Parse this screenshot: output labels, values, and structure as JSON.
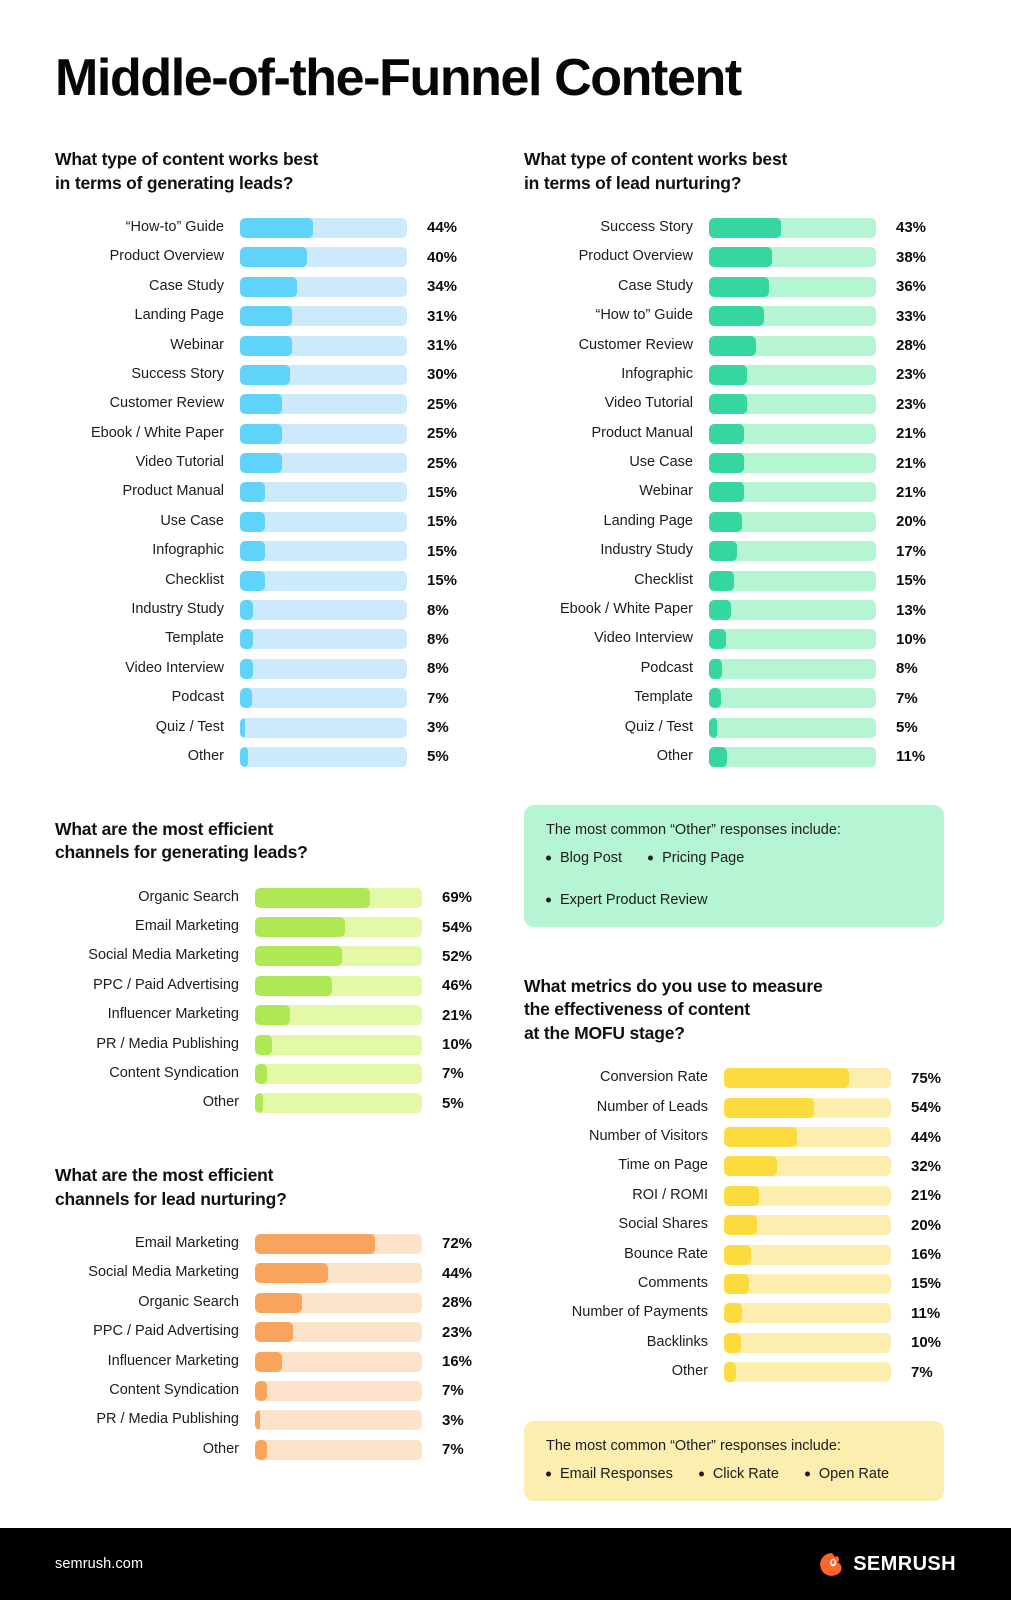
{
  "title": "Middle-of-the-Funnel Content",
  "colors": {
    "blue_fill": "#5FD3F9",
    "blue_track": "#CDEAFD",
    "green_fill": "#35D6A0",
    "green_track": "#B6F5D4",
    "lime_fill": "#AEE855",
    "lime_track": "#E3F9A7",
    "orange_fill": "#F8A45C",
    "orange_track": "#FCE2C9",
    "yellow_fill": "#FCDB3F",
    "yellow_track": "#FCEEAE",
    "footer_bg": "#000000",
    "brand_orange": "#FF642D"
  },
  "footer": {
    "url": "semrush.com",
    "logo_text": "SEMRUSH",
    "logo_icon": "semrush-flame-icon"
  },
  "callouts": {
    "green": {
      "title": "The most common “Other” responses include:",
      "items": [
        "Blog Post",
        "Pricing Page",
        "Expert Product Review"
      ]
    },
    "yellow": {
      "title": "The most common “Other” responses include:",
      "items": [
        "Email Responses",
        "Click Rate",
        "Open Rate"
      ]
    }
  },
  "chart_data": [
    {
      "id": "leads-content",
      "type": "bar",
      "orientation": "horizontal",
      "title": "What type of content works best\nin terms of generating leads?",
      "xlabel": "",
      "ylabel": "",
      "xlim": [
        0,
        100
      ],
      "grid": false,
      "legend": "none",
      "unit": "%",
      "theme": "blue",
      "categories": [
        "“How-to” Guide",
        "Product Overview",
        "Case Study",
        "Landing Page",
        "Webinar",
        "Success Story",
        "Customer Review",
        "Ebook / White Paper",
        "Video Tutorial",
        "Product Manual",
        "Use Case",
        "Infographic",
        "Checklist",
        "Industry Study",
        "Template",
        "Video Interview",
        "Podcast",
        "Quiz / Test",
        "Other"
      ],
      "values": [
        44,
        40,
        34,
        31,
        31,
        30,
        25,
        25,
        25,
        15,
        15,
        15,
        15,
        8,
        8,
        8,
        7,
        3,
        5
      ],
      "labels": [
        "44%",
        "40%",
        "34%",
        "31%",
        "31%",
        "30%",
        "25%",
        "25%",
        "25%",
        "15%",
        "15%",
        "15%",
        "15%",
        "8%",
        "8%",
        "8%",
        "7%",
        "3%",
        "5%"
      ]
    },
    {
      "id": "nurturing-content",
      "type": "bar",
      "orientation": "horizontal",
      "title": "What type of content works best\nin terms of lead nurturing?",
      "xlabel": "",
      "ylabel": "",
      "xlim": [
        0,
        100
      ],
      "grid": false,
      "legend": "none",
      "unit": "%",
      "theme": "green",
      "categories": [
        "Success Story",
        "Product Overview",
        "Case Study",
        "“How to” Guide",
        "Customer Review",
        "Infographic",
        "Video Tutorial",
        "Product Manual",
        "Use Case",
        "Webinar",
        "Landing Page",
        "Industry Study",
        "Checklist",
        "Ebook / White Paper",
        "Video Interview",
        "Podcast",
        "Template",
        "Quiz / Test",
        "Other"
      ],
      "values": [
        43,
        38,
        36,
        33,
        28,
        23,
        23,
        21,
        21,
        21,
        20,
        17,
        15,
        13,
        10,
        8,
        7,
        5,
        11
      ],
      "labels": [
        "43%",
        "38%",
        "36%",
        "33%",
        "28%",
        "23%",
        "23%",
        "21%",
        "21%",
        "21%",
        "20%",
        "17%",
        "15%",
        "13%",
        "10%",
        "8%",
        "7%",
        "5%",
        "11%"
      ]
    },
    {
      "id": "leads-channels",
      "type": "bar",
      "orientation": "horizontal",
      "title": "What are the most efficient\nchannels for generating leads?",
      "xlabel": "",
      "ylabel": "",
      "xlim": [
        0,
        100
      ],
      "grid": false,
      "legend": "none",
      "unit": "%",
      "theme": "lime",
      "categories": [
        "Organic Search",
        "Email Marketing",
        "Social Media Marketing",
        "PPC / Paid Advertising",
        "Influencer Marketing",
        "PR / Media Publishing",
        "Content Syndication",
        "Other"
      ],
      "values": [
        69,
        54,
        52,
        46,
        21,
        10,
        7,
        5
      ],
      "labels": [
        "69%",
        "54%",
        "52%",
        "46%",
        "21%",
        "10%",
        "7%",
        "5%"
      ]
    },
    {
      "id": "nurturing-channels",
      "type": "bar",
      "orientation": "horizontal",
      "title": "What are the most efficient\nchannels for lead nurturing?",
      "xlabel": "",
      "ylabel": "",
      "xlim": [
        0,
        100
      ],
      "grid": false,
      "legend": "none",
      "unit": "%",
      "theme": "orange",
      "categories": [
        "Email Marketing",
        "Social Media Marketing",
        "Organic Search",
        "PPC / Paid Advertising",
        "Influencer Marketing",
        "Content Syndication",
        "PR / Media Publishing",
        "Other"
      ],
      "values": [
        72,
        44,
        28,
        23,
        16,
        7,
        3,
        7
      ],
      "labels": [
        "72%",
        "44%",
        "28%",
        "23%",
        "16%",
        "7%",
        "3%",
        "7%"
      ]
    },
    {
      "id": "mofu-metrics",
      "type": "bar",
      "orientation": "horizontal",
      "title": "What metrics do you use to measure\nthe effectiveness of content\nat the MOFU stage?",
      "xlabel": "",
      "ylabel": "",
      "xlim": [
        0,
        100
      ],
      "grid": false,
      "legend": "none",
      "unit": "%",
      "theme": "yellow",
      "categories": [
        "Conversion Rate",
        "Number of Leads",
        "Number of Visitors",
        "Time on Page",
        "ROI / ROMI",
        "Social Shares",
        "Bounce Rate",
        "Comments",
        "Number of Payments",
        "Backlinks",
        "Other"
      ],
      "values": [
        75,
        54,
        44,
        32,
        21,
        20,
        16,
        15,
        11,
        10,
        7
      ],
      "labels": [
        "75%",
        "54%",
        "44%",
        "32%",
        "21%",
        "20%",
        "16%",
        "15%",
        "11%",
        "10%",
        "7%"
      ]
    }
  ]
}
